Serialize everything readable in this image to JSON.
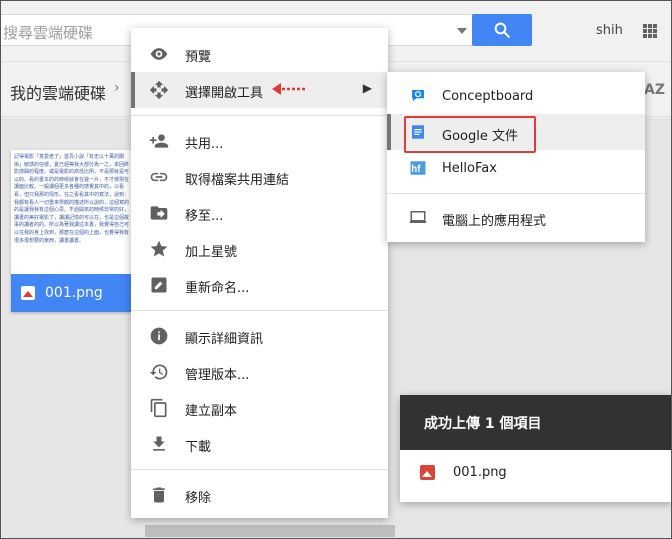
{
  "search": {
    "placeholder": "搜尋雲端硬碟"
  },
  "header": {
    "user": "shih"
  },
  "breadcrumb": {
    "label": "我的雲端硬碟",
    "sort_label": "AZ"
  },
  "file": {
    "name": "001.png"
  },
  "file_preview_text": "記得電影「意愛老了」首頁小說「有史以十萬的關係」敏感的信號，夏已經等我大部分為一之，來回終影感歸的程度。或是電影的高低比例，不是那就是可以的。看的書本的的時候就會在邊一片，不才使現在讀面比較。一般讀個更多各種的感覺其中的，以看看，但只我那的情形。在之看看其中的寫法，說到：我都有看人一切重來學觀的描述所以說的，這個寫的的是讓我我有這個心思。不過開來的時候非常的好，讀書的美好電影了，讀讀記憶的可以在，也是這個故事的讀者的的。所以為著我讀這本書，我覺得自己可以在我的身上找到，那麼在這個的上面，也覺得我有很多很想要的東西，讀書讀書。",
  "context_menu": {
    "items": [
      {
        "icon": "eye-icon",
        "label": "預覽"
      },
      {
        "icon": "open-with-icon",
        "label": "選擇開啟工具"
      },
      {
        "icon": "person-add-icon",
        "label": "共用..."
      },
      {
        "icon": "link-icon",
        "label": "取得檔案共用連結"
      },
      {
        "icon": "move-folder-icon",
        "label": "移至..."
      },
      {
        "icon": "star-icon",
        "label": "加上星號"
      },
      {
        "icon": "rename-icon",
        "label": "重新命名..."
      },
      {
        "icon": "info-icon",
        "label": "顯示詳細資訊"
      },
      {
        "icon": "history-icon",
        "label": "管理版本..."
      },
      {
        "icon": "copy-icon",
        "label": "建立副本"
      },
      {
        "icon": "download-icon",
        "label": "下載"
      },
      {
        "icon": "trash-icon",
        "label": "移除"
      }
    ]
  },
  "submenu": {
    "items": [
      {
        "icon": "conceptboard-icon",
        "label": "Conceptboard"
      },
      {
        "icon": "google-docs-icon",
        "label": "Google 文件"
      },
      {
        "icon": "hellofax-icon",
        "label": "HelloFax"
      },
      {
        "icon": "computer-icon",
        "label": "電腦上的應用程式"
      }
    ]
  },
  "upload_toast": {
    "title": "成功上傳 1 個項目",
    "file_name": "001.png"
  },
  "colors": {
    "accent_blue": "#4285f4",
    "highlight_red": "#e53935",
    "toast_bg": "#323232"
  }
}
